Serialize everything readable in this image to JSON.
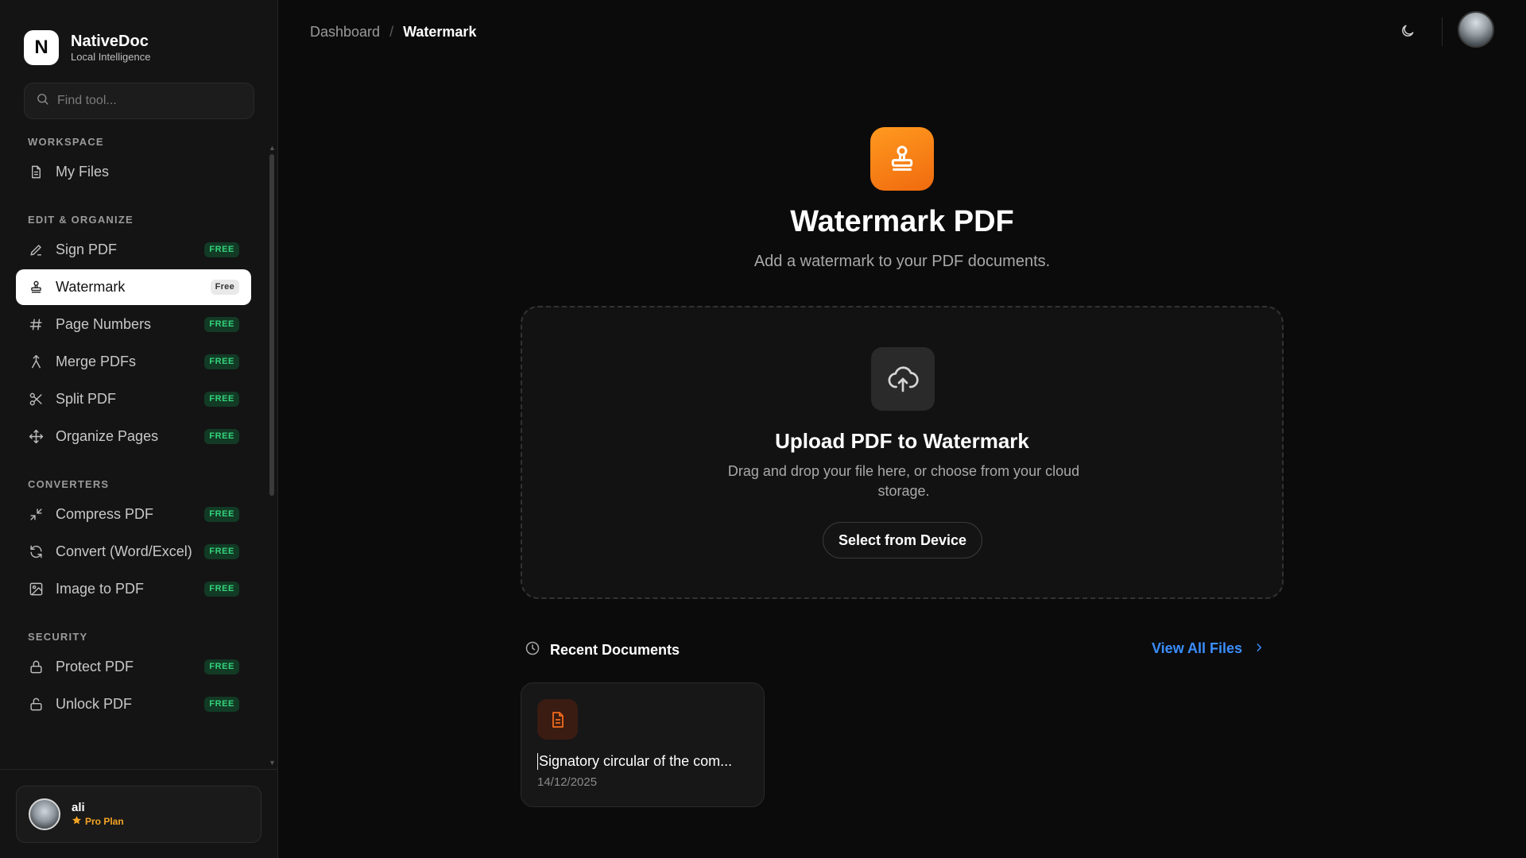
{
  "brand": {
    "name": "NativeDoc",
    "subtitle": "Local Intelligence",
    "logo_letter": "N"
  },
  "search": {
    "placeholder": "Find tool..."
  },
  "sidebar": {
    "sections": [
      {
        "title": "WORKSPACE",
        "items": [
          {
            "label": "My Files",
            "icon": "file-icon"
          }
        ]
      },
      {
        "title": "EDIT & ORGANIZE",
        "items": [
          {
            "label": "Sign PDF",
            "badge": "FREE",
            "icon": "pen-icon"
          },
          {
            "label": "Watermark",
            "badge": "Free",
            "icon": "stamp-icon",
            "active": true
          },
          {
            "label": "Page Numbers",
            "badge": "FREE",
            "icon": "hash-icon"
          },
          {
            "label": "Merge PDFs",
            "badge": "FREE",
            "icon": "merge-icon"
          },
          {
            "label": "Split PDF",
            "badge": "FREE",
            "icon": "scissors-icon"
          },
          {
            "label": "Organize Pages",
            "badge": "FREE",
            "icon": "move-icon"
          }
        ]
      },
      {
        "title": "CONVERTERS",
        "items": [
          {
            "label": "Compress PDF",
            "badge": "FREE",
            "icon": "minimize-icon"
          },
          {
            "label": "Convert (Word/Excel)",
            "badge": "FREE",
            "icon": "refresh-icon"
          },
          {
            "label": "Image to PDF",
            "badge": "FREE",
            "icon": "image-icon"
          }
        ]
      },
      {
        "title": "SECURITY",
        "items": [
          {
            "label": "Protect PDF",
            "badge": "FREE",
            "icon": "lock-icon"
          },
          {
            "label": "Unlock PDF",
            "badge": "FREE",
            "icon": "unlock-icon"
          }
        ]
      }
    ]
  },
  "user": {
    "name": "ali",
    "plan": "Pro Plan"
  },
  "breadcrumb": {
    "parent": "Dashboard",
    "separator": "/",
    "current": "Watermark"
  },
  "hero": {
    "title": "Watermark PDF",
    "subtitle": "Add a watermark to your PDF documents.",
    "icon": "stamp-icon"
  },
  "upload": {
    "title": "Upload PDF to Watermark",
    "description": "Drag and drop your file here, or choose from your cloud storage.",
    "button": "Select from Device",
    "icon": "cloud-upload-icon"
  },
  "recent": {
    "title": "Recent Documents",
    "view_all": "View All Files",
    "documents": [
      {
        "name": "Signatory circular of the com...",
        "date": "14/12/2025"
      }
    ]
  },
  "colors": {
    "accent_orange": "#f57c14",
    "badge_green": "#34d27a",
    "link_blue": "#3b8eff",
    "plan_gold": "#f5a524"
  }
}
